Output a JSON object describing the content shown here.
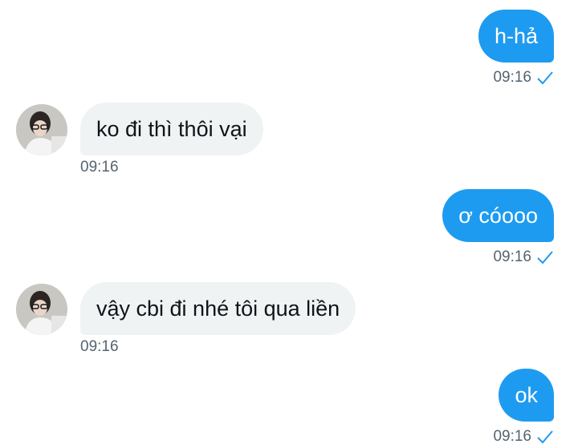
{
  "messages": [
    {
      "side": "out",
      "text": "h-hả",
      "time": "09:16"
    },
    {
      "side": "in",
      "text": "ko đi thì thôi vại",
      "time": "09:16"
    },
    {
      "side": "out",
      "text": "ơ cóooo",
      "time": "09:16"
    },
    {
      "side": "in",
      "text": "vậy cbi đi nhé tôi qua liền",
      "time": "09:16"
    },
    {
      "side": "out",
      "text": "ok",
      "time": "09:16"
    }
  ],
  "colors": {
    "outgoing_bubble": "#1d9bf0",
    "incoming_bubble": "#eff3f4",
    "timestamp": "#536471",
    "read_check": "#1d9bf0"
  },
  "icons": {
    "read_receipt": "check-icon",
    "avatar": "user-avatar-photo"
  }
}
